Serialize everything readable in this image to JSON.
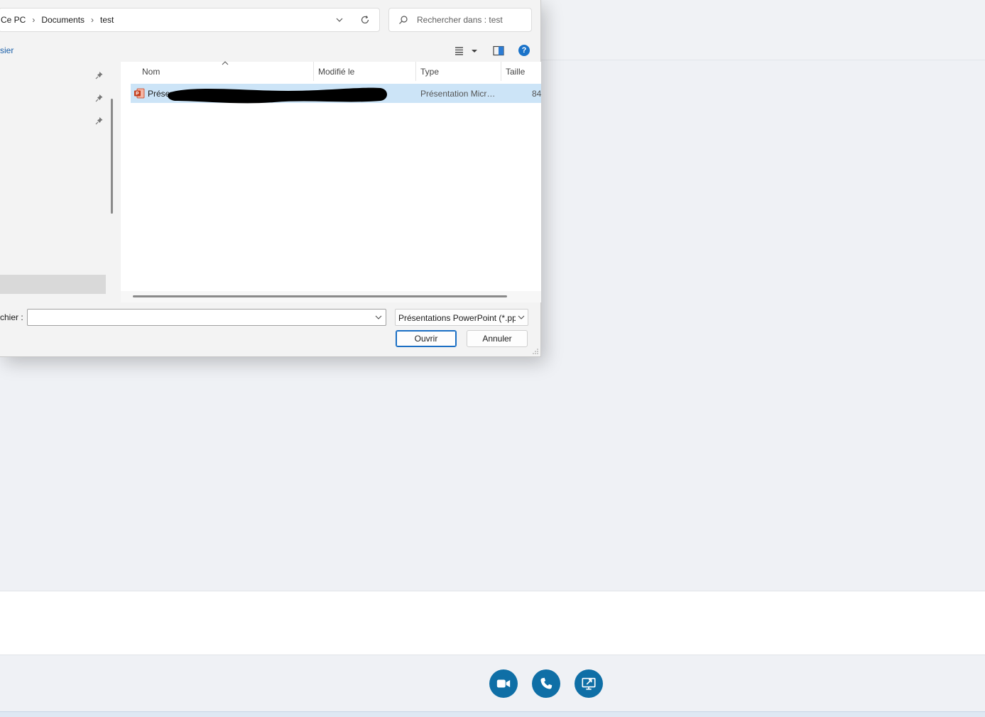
{
  "dialog": {
    "breadcrumb": [
      "Ce PC",
      "Documents",
      "test"
    ],
    "search_placeholder": "Rechercher dans : test",
    "new_folder_label": "sier",
    "help_label": "?",
    "columns": {
      "name": "Nom",
      "modified": "Modifié le",
      "type": "Type",
      "size": "Taille"
    },
    "file": {
      "name": "Présen",
      "type": "Présentation Micr…",
      "size": "84"
    },
    "filename_label": "chier :",
    "filename_value": "",
    "filter_label": "Présentations PowerPoint (*.pp",
    "open_label": "Ouvrir",
    "cancel_label": "Annuler"
  },
  "colors": {
    "accent": "#0f6fa6",
    "selection": "#cce4f7",
    "link": "#1a5fa8"
  },
  "action_buttons": [
    "video-call-icon",
    "phone-icon",
    "share-screen-icon"
  ]
}
